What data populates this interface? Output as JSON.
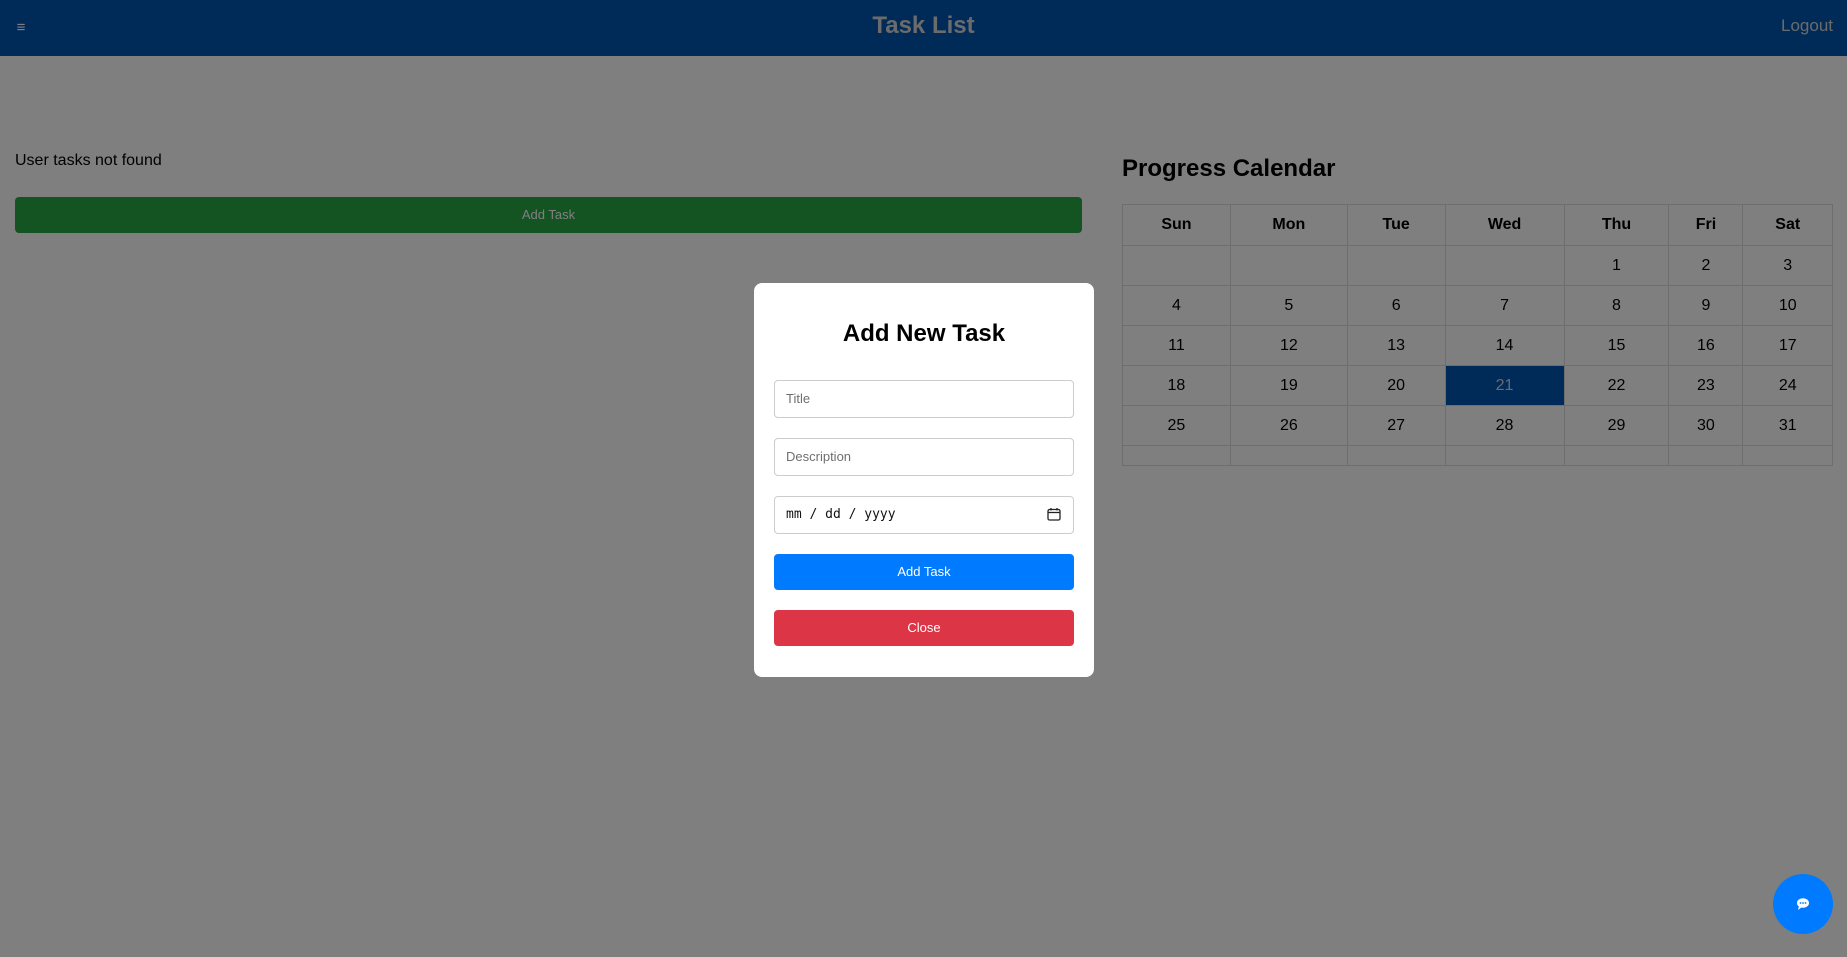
{
  "navbar": {
    "menu_glyph": "≡",
    "title": "Task List",
    "logout_label": "Logout",
    "color": "#0056b3"
  },
  "tasks": {
    "empty_message": "User tasks not found",
    "add_button_label": "Add Task"
  },
  "calendar": {
    "title": "Progress Calendar",
    "weekdays": [
      "Sun",
      "Mon",
      "Tue",
      "Wed",
      "Thu",
      "Fri",
      "Sat"
    ],
    "weeks": [
      [
        "",
        "",
        "",
        "",
        "1",
        "2",
        "3"
      ],
      [
        "4",
        "5",
        "6",
        "7",
        "8",
        "9",
        "10"
      ],
      [
        "11",
        "12",
        "13",
        "14",
        "15",
        "16",
        "17"
      ],
      [
        "18",
        "19",
        "20",
        "21",
        "22",
        "23",
        "24"
      ],
      [
        "25",
        "26",
        "27",
        "28",
        "29",
        "30",
        "31"
      ]
    ],
    "highlighted_day": "21",
    "highlight_color": "#0056b3"
  },
  "modal": {
    "title": "Add New Task",
    "title_placeholder": "Title",
    "description_placeholder": "Description",
    "date_placeholder": "mm / dd / yyyy",
    "add_button_label": "Add Task",
    "close_button_label": "Close",
    "add_button_color": "#007bff",
    "close_button_color": "#dc3545"
  },
  "chat": {
    "icon": "chat-icon",
    "color": "#007bff"
  }
}
